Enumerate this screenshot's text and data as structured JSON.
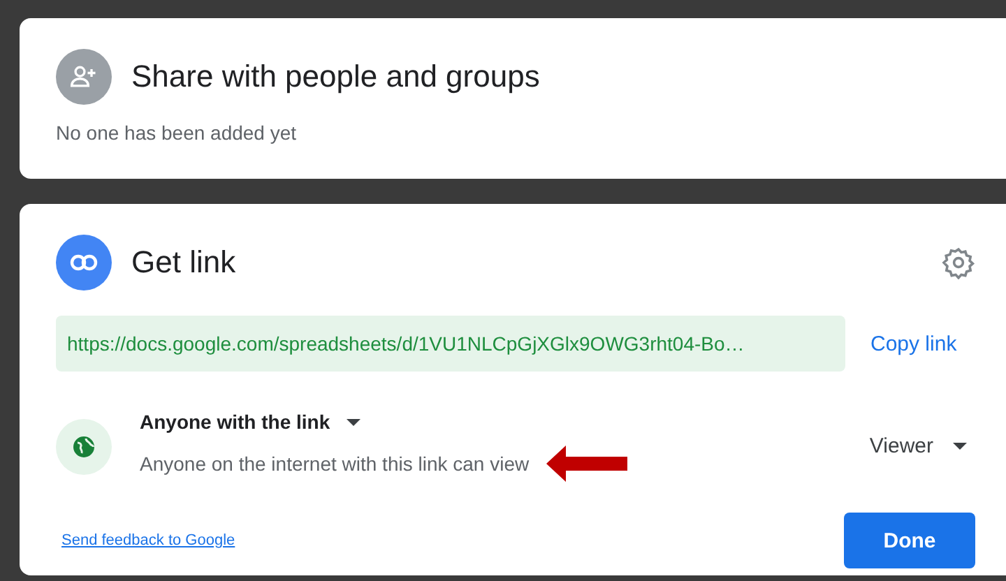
{
  "share_panel": {
    "title": "Share with people and groups",
    "subtitle": "No one has been added yet"
  },
  "link_panel": {
    "title": "Get link",
    "url": "https://docs.google.com/spreadsheets/d/1VU1NLCpGjXGlx9OWG3rht04-Bo…",
    "copy_label": "Copy link",
    "access": {
      "scope": "Anyone with the link",
      "description": "Anyone on the internet with this link can view",
      "role": "Viewer"
    },
    "feedback_link": "Send feedback to Google",
    "done_button": "Done"
  }
}
